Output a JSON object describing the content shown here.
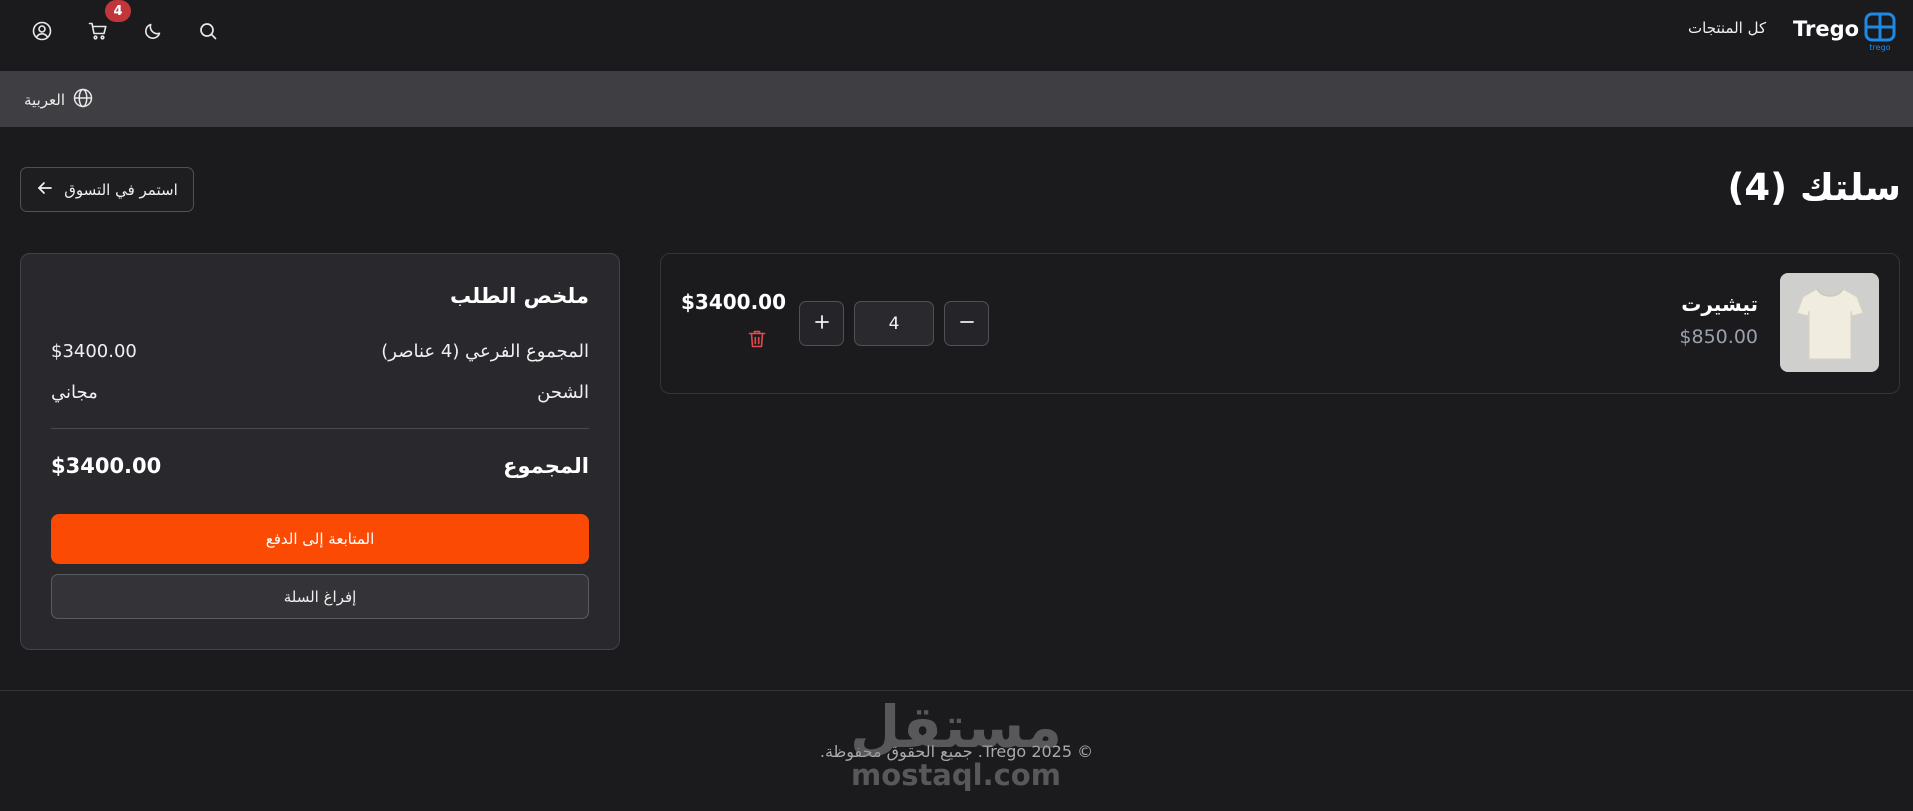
{
  "header": {
    "brand": "Trego",
    "brand_mark_text": "trego",
    "nav_all_products": "كل المنتجات",
    "cart_count": "4",
    "icons": [
      "profile-icon",
      "cart-icon",
      "moon-icon",
      "search-icon"
    ]
  },
  "language": {
    "label": "العربية",
    "icon": "globe-icon"
  },
  "page": {
    "title": "سلتك (4)",
    "continue_shopping": "استمر في التسوق"
  },
  "cart": {
    "items": [
      {
        "name": "تيشيرت",
        "unit_price": "$850.00",
        "quantity": "4",
        "line_total": "$3400.00"
      }
    ]
  },
  "summary": {
    "title": "ملخص الطلب",
    "subtotal_label": "المجموع الفرعي (4 عناصر)",
    "subtotal_value": "$3400.00",
    "shipping_label": "الشحن",
    "shipping_value": "مجاني",
    "total_label": "المجموع",
    "total_value": "$3400.00",
    "checkout_button": "المتابعة إلى الدفع",
    "clear_button": "إفراغ السلة"
  },
  "footer": {
    "copyright": "© 2025 Trego. جميع الحقوق محفوظة."
  },
  "watermark": {
    "arabic": "مستقل",
    "latin": "mostaql.com"
  },
  "colors": {
    "background": "#1b1b1e",
    "accent": "#fa4a03",
    "badge": "#c0363a",
    "brand_blue": "#1e88e5",
    "danger": "#e5484d"
  }
}
